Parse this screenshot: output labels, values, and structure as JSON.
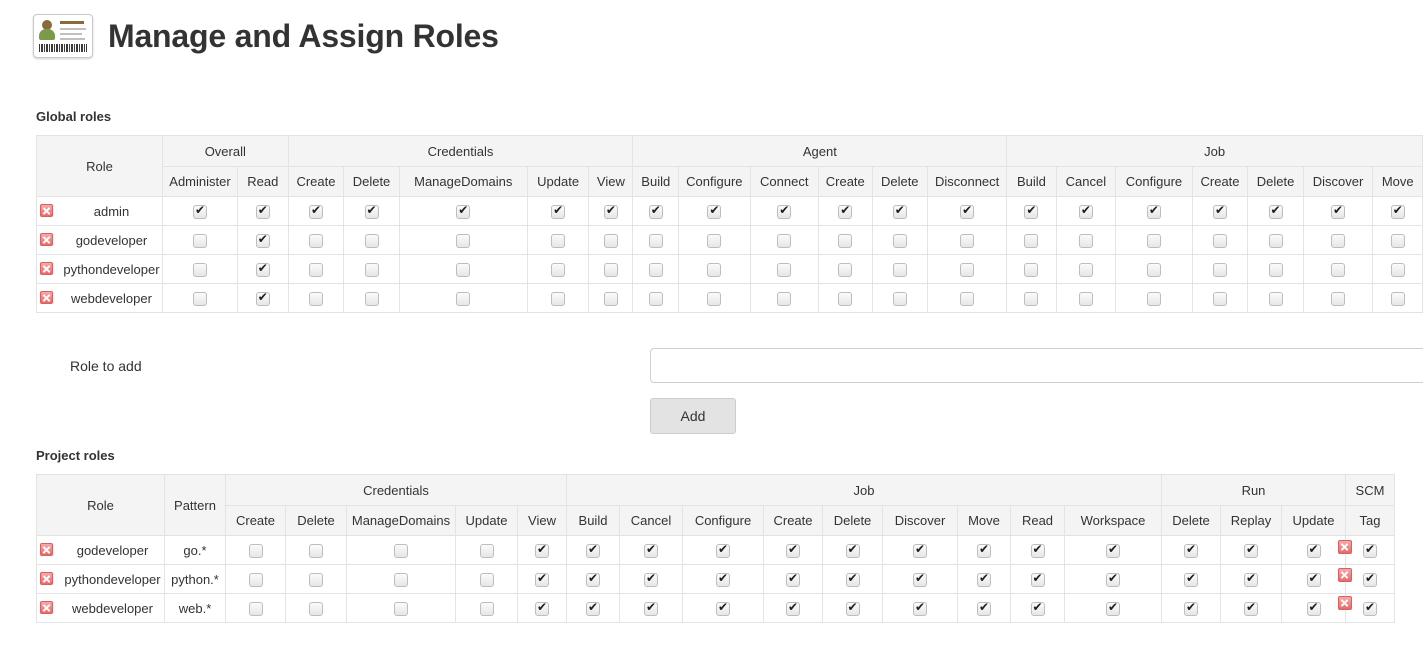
{
  "header": {
    "title": "Manage and Assign Roles",
    "badge_icon": "id-badge-icon"
  },
  "global": {
    "section_label": "Global roles",
    "role_column": "Role",
    "groups": [
      {
        "name": "Overall",
        "columns": [
          "Administer",
          "Read"
        ]
      },
      {
        "name": "Credentials",
        "columns": [
          "Create",
          "Delete",
          "ManageDomains",
          "Update",
          "View"
        ]
      },
      {
        "name": "Agent",
        "columns": [
          "Build",
          "Configure",
          "Connect",
          "Create",
          "Delete",
          "Disconnect"
        ]
      },
      {
        "name": "Job",
        "columns": [
          "Build",
          "Cancel",
          "Configure",
          "Create",
          "Delete",
          "Discover",
          "Move"
        ]
      }
    ],
    "rows": [
      {
        "role": "admin",
        "values": [
          true,
          true,
          true,
          true,
          true,
          true,
          true,
          true,
          true,
          true,
          true,
          true,
          true,
          true,
          true,
          true,
          true,
          true,
          true,
          true
        ]
      },
      {
        "role": "godeveloper",
        "values": [
          false,
          true,
          false,
          false,
          false,
          false,
          false,
          false,
          false,
          false,
          false,
          false,
          false,
          false,
          false,
          false,
          false,
          false,
          false,
          false
        ]
      },
      {
        "role": "pythondeveloper",
        "values": [
          false,
          true,
          false,
          false,
          false,
          false,
          false,
          false,
          false,
          false,
          false,
          false,
          false,
          false,
          false,
          false,
          false,
          false,
          false,
          false
        ]
      },
      {
        "role": "webdeveloper",
        "values": [
          false,
          true,
          false,
          false,
          false,
          false,
          false,
          false,
          false,
          false,
          false,
          false,
          false,
          false,
          false,
          false,
          false,
          false,
          false,
          false
        ]
      }
    ],
    "delete_icon": "delete-role-icon"
  },
  "add_form": {
    "label": "Role to add",
    "input_value": "",
    "input_placeholder": "",
    "button_label": "Add"
  },
  "project": {
    "section_label": "Project roles",
    "role_column": "Role",
    "pattern_column": "Pattern",
    "groups": [
      {
        "name": "Credentials",
        "columns": [
          "Create",
          "Delete",
          "ManageDomains",
          "Update",
          "View"
        ]
      },
      {
        "name": "Job",
        "columns": [
          "Build",
          "Cancel",
          "Configure",
          "Create",
          "Delete",
          "Discover",
          "Move",
          "Read",
          "Workspace"
        ]
      },
      {
        "name": "Run",
        "columns": [
          "Delete",
          "Replay",
          "Update"
        ]
      },
      {
        "name": "SCM",
        "columns": [
          "Tag"
        ]
      }
    ],
    "rows": [
      {
        "role": "godeveloper",
        "pattern": "go.*",
        "values": [
          false,
          false,
          false,
          false,
          true,
          true,
          true,
          true,
          true,
          true,
          true,
          true,
          true,
          true,
          true,
          true,
          true,
          true
        ]
      },
      {
        "role": "pythondeveloper",
        "pattern": "python.*",
        "values": [
          false,
          false,
          false,
          false,
          true,
          true,
          true,
          true,
          true,
          true,
          true,
          true,
          true,
          true,
          true,
          true,
          true,
          true
        ]
      },
      {
        "role": "webdeveloper",
        "pattern": "web.*",
        "values": [
          false,
          false,
          false,
          false,
          true,
          true,
          true,
          true,
          true,
          true,
          true,
          true,
          true,
          true,
          true,
          true,
          true,
          true
        ]
      }
    ],
    "delete_icon": "delete-role-icon"
  },
  "colors": {
    "header_bg": "#f4f4f4",
    "border": "#e3e3e3",
    "text": "#333333",
    "delete_red": "#e86a6a",
    "button_bg": "#e3e3e3"
  }
}
